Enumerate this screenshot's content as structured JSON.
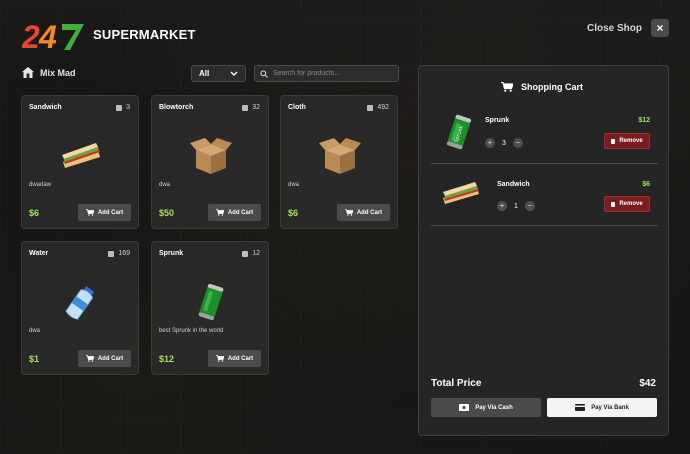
{
  "header": {
    "logo_text": "24/7",
    "title": "SUPERMARKET",
    "close_label": "Close Shop",
    "close_icon": "close-icon"
  },
  "toolbar": {
    "player_name": "Mix Mad",
    "filter_selected": "All",
    "search_placeholder": "Search for products..."
  },
  "products": [
    {
      "name": "Sandwich",
      "stock": "3",
      "description": "dwadaw",
      "price": "$6",
      "add_label": "Add Cart",
      "icon": "sandwich"
    },
    {
      "name": "Blowtorch",
      "stock": "32",
      "description": "dwa",
      "price": "$50",
      "add_label": "Add Cart",
      "icon": "box"
    },
    {
      "name": "Cloth",
      "stock": "492",
      "description": "dwa",
      "price": "$6",
      "add_label": "Add Cart",
      "icon": "box"
    },
    {
      "name": "Water",
      "stock": "169",
      "description": "dwa",
      "price": "$1",
      "add_label": "Add Cart",
      "icon": "water-bottle"
    },
    {
      "name": "Sprunk",
      "stock": "12",
      "description": "best Sprunk in the world",
      "price": "$12",
      "add_label": "Add Cart",
      "icon": "soda-can"
    }
  ],
  "cart": {
    "title": "Shopping Cart",
    "items": [
      {
        "name": "Sprunk",
        "price": "$12",
        "quantity": "3",
        "remove_label": "Remove",
        "icon": "soda-can"
      },
      {
        "name": "Sandwich",
        "price": "$6",
        "quantity": "1",
        "remove_label": "Remove",
        "icon": "sandwich"
      }
    ],
    "total_label": "Total Price",
    "total_value": "$42",
    "pay_cash_label": "Pay Via Cash",
    "pay_bank_label": "Pay Via Bank"
  },
  "colors": {
    "price_green": "#a6e05a",
    "logo_red": "#e8452c",
    "logo_green": "#3fae3a",
    "remove_red": "#7a1d1f"
  }
}
